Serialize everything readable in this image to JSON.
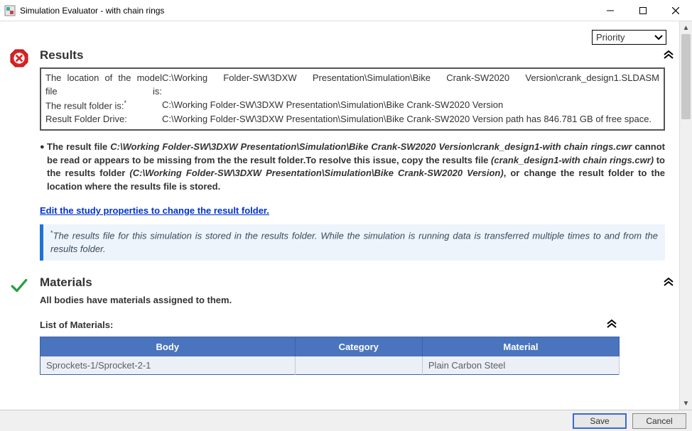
{
  "window": {
    "title": "Simulation Evaluator - with chain rings"
  },
  "toolbar": {
    "priority_label": "Priority"
  },
  "results": {
    "heading": "Results",
    "loc_label": "The location of the model file is:",
    "loc_value": "C:\\Working Folder-SW\\3DXW Presentation\\Simulation\\Bike Crank-SW2020 Version\\crank_design1.SLDASM",
    "folder_label": "The result folder is:",
    "folder_value": "C:\\Working Folder-SW\\3DXW Presentation\\Simulation\\Bike Crank-SW2020 Version",
    "drive_label": "Result Folder Drive:",
    "drive_value": "C:\\Working Folder-SW\\3DXW Presentation\\Simulation\\Bike Crank-SW2020 Version path has 846.781 GB of free space.",
    "warn_pre": "The result file ",
    "warn_path1": "C:\\Working Folder-SW\\3DXW Presentation\\Simulation\\Bike Crank-SW2020 Version\\crank_design1-with chain rings.cwr",
    "warn_mid1": " cannot be read or appears to be missing from the the result folder.To resolve this issue, copy the results file ",
    "warn_path2": "(crank_design1-with chain rings.cwr)",
    "warn_mid2": " to the results folder ",
    "warn_path3": "(C:\\Working Folder-SW\\3DXW Presentation\\Simulation\\Bike Crank-SW2020 Version)",
    "warn_end": ", or change the result folder to the location where the results file is stored.",
    "link": "Edit the study properties to change the result folder.",
    "note": "The results file for this simulation is stored in the results folder. While the simulation is running data is transferred multiple times to and from the results folder."
  },
  "materials": {
    "heading": "Materials",
    "assigned": "All bodies have materials assigned to them.",
    "list_title": "List of Materials:",
    "headers": {
      "body": "Body",
      "category": "Category",
      "material": "Material"
    },
    "rows": [
      {
        "body": "Sprockets-1/Sprocket-2-1",
        "category": "",
        "material": "Plain Carbon Steel"
      }
    ]
  },
  "footer": {
    "save": "Save",
    "cancel": "Cancel"
  }
}
